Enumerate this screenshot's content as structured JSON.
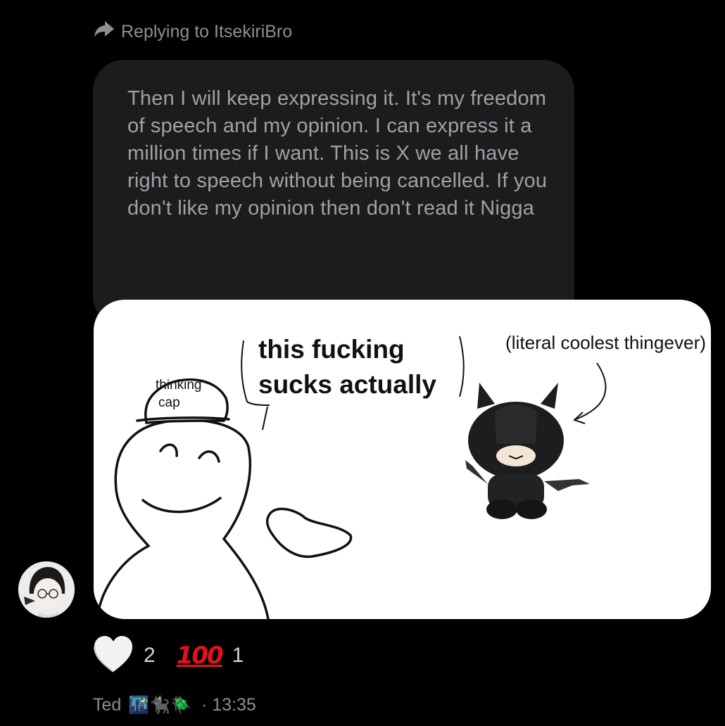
{
  "reply": {
    "label": "Replying to ItsekiriBro",
    "icon": "reply-arrow-icon"
  },
  "message": {
    "text": "Then I will keep expressing it. It's my freedom of speech and my opinion. I can express it a million times if I want. This is X we all have right to speech without being cancelled. If you don't like my opinion then don't read it Nigga"
  },
  "meme": {
    "cap_text_1": "thinking",
    "cap_text_2": "cap",
    "speech_line_1": "this fucking",
    "speech_line_2": "sucks actually",
    "annotation": "(literal coolest thingever)"
  },
  "reactions": [
    {
      "icon": "white-heart-icon",
      "count": "2"
    },
    {
      "icon": "hundred-points-icon",
      "glyph": "100",
      "count": "1"
    }
  ],
  "footer": {
    "sender": "Ted",
    "emoji": "🌃🐈‍⬛🪲",
    "time": "· 13:35"
  },
  "colors": {
    "background": "#000000",
    "bubble": "#1c1c1e",
    "secondary_text": "#8e8e93",
    "hundred_red": "#e0131d"
  }
}
